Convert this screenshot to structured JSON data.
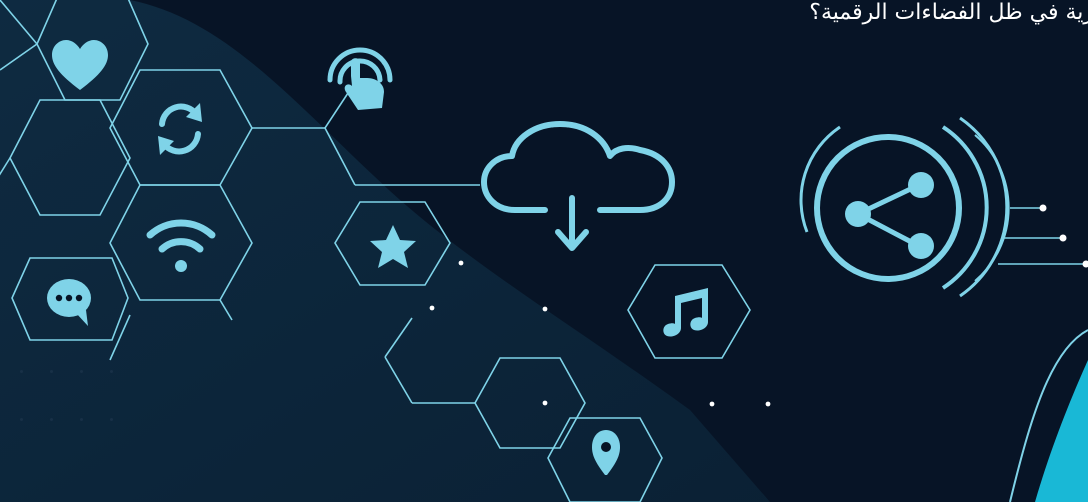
{
  "headline": "رية في ظل الفضاءات الرقمية؟",
  "colors": {
    "background": "#071426",
    "accent": "#7fd3e8",
    "shape": "#0f2a3d",
    "highlight": "#19b8d6"
  },
  "icons": [
    "heart-icon",
    "sync-icon",
    "wifi-icon",
    "chat-icon",
    "touch-icon",
    "cloud-download-icon",
    "star-icon",
    "music-icon",
    "location-pin-icon",
    "share-icon"
  ]
}
